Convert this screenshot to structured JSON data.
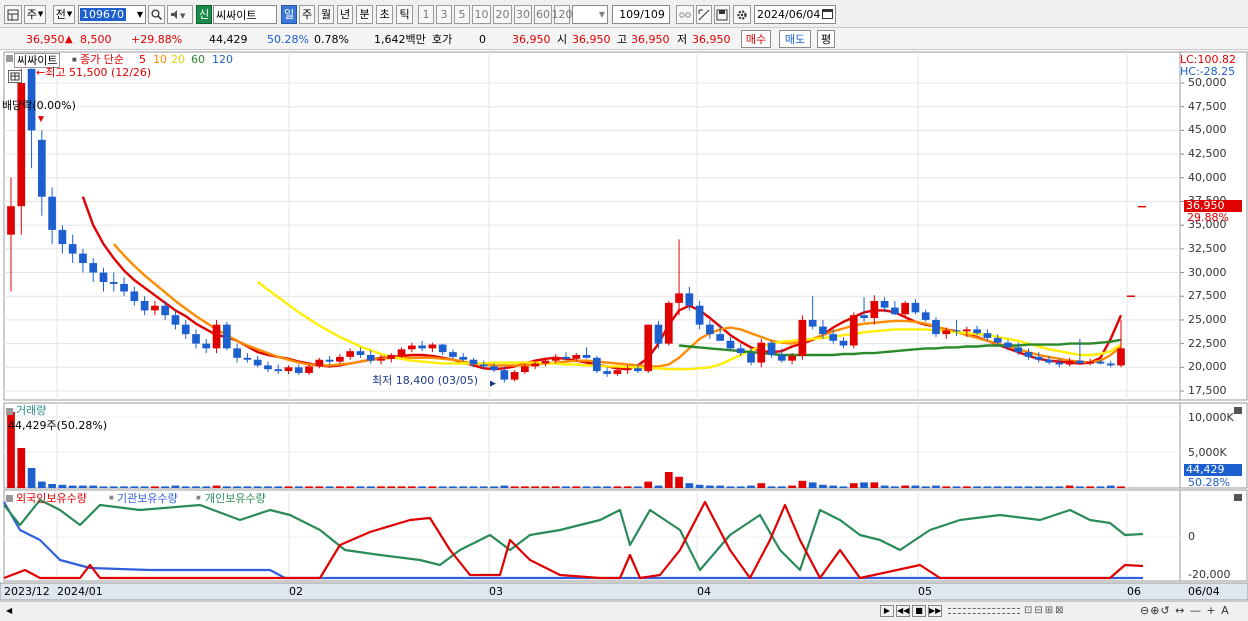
{
  "toolbar": {
    "period": "주",
    "prev": "전",
    "code": "109670",
    "badge": "신",
    "name": "씨싸이트",
    "periods": [
      "일",
      "주",
      "월",
      "년",
      "분",
      "초",
      "틱"
    ],
    "active_period": "일",
    "intervals": [
      "1",
      "3",
      "5",
      "10",
      "20",
      "30",
      "60",
      "120"
    ],
    "count": "109",
    "count_total": "/109",
    "date": "2024/06/04"
  },
  "quote": {
    "price": "36,950",
    "change": "8,500",
    "change_pct": "+29.88%",
    "volume": "44,429",
    "vol_ratio": "50.28%",
    "turnover": "0.78%",
    "amount": "1,642백만",
    "hoga_label": "호가",
    "hoga_value": "0",
    "hoga_price": "36,950",
    "open_label": "시",
    "open": "36,950",
    "high_label": "고",
    "high": "36,950",
    "low_label": "저",
    "low": "36,950",
    "buy": "매수",
    "sell": "매도",
    "avg": "평"
  },
  "price_panel": {
    "name": "씨싸이트",
    "ma_label": "종가 단순",
    "ma_periods": [
      "5",
      "10",
      "20",
      "60",
      "120"
    ],
    "ma_colors": [
      "#e00000",
      "#ff8c00",
      "#ffee00",
      "#2a8a2a",
      "#1e64c8"
    ],
    "high_note": "←최고 51,500 (12/26)",
    "low_note": "최저 18,400 (03/05)",
    "dividend": "배당락(0.00%)",
    "lc": "LC:100.82",
    "hc": "HC:-28.25",
    "current_price_tag": "36,950",
    "current_pct_tag": "29.88%",
    "y_ticks": [
      "50,000",
      "47,500",
      "45,000",
      "42,500",
      "40,000",
      "37,500",
      "35,000",
      "32,500",
      "30,000",
      "27,500",
      "25,000",
      "22,500",
      "20,000",
      "17,500"
    ]
  },
  "volume_panel": {
    "title": "거래량",
    "note": "44,429주(50.28%)",
    "y_ticks": [
      "10,000K",
      "5,000K"
    ],
    "value_tag": "44,429",
    "pct_tag": "50.28%"
  },
  "holding_panel": {
    "legend": [
      "외국인보유수량",
      "기관보유수량",
      "개인보유수량"
    ],
    "legend_colors": [
      "#e00000",
      "#3060e0",
      "#2a8a5a"
    ],
    "y_ticks": [
      "0",
      "-20,000"
    ]
  },
  "x_axis": {
    "labels": [
      "2023/12",
      "2024/01",
      "02",
      "03",
      "04",
      "05",
      "06"
    ],
    "end_label": "06/04"
  },
  "colors": {
    "up": "#e00000",
    "down": "#1e5fd0",
    "accent_tag": "#e00000"
  },
  "chart_data": {
    "type": "candlestick",
    "y_range": [
      16000,
      52000
    ],
    "series": [
      {
        "name": "candles",
        "ohlc": [
          [
            34000,
            40000,
            28000,
            37000
          ],
          [
            37000,
            51500,
            34000,
            50000
          ],
          [
            51500,
            51500,
            41000,
            45000
          ],
          [
            44000,
            45000,
            36000,
            38000
          ],
          [
            38000,
            39000,
            33000,
            34500
          ],
          [
            34500,
            35000,
            32000,
            33000
          ],
          [
            33000,
            34000,
            31000,
            32000
          ],
          [
            32000,
            32500,
            30000,
            31000
          ],
          [
            31000,
            31500,
            29000,
            30000
          ],
          [
            30000,
            30500,
            28000,
            29000
          ],
          [
            29000,
            30000,
            28000,
            28800
          ],
          [
            28800,
            29500,
            27500,
            28000
          ],
          [
            28000,
            28500,
            26500,
            27000
          ],
          [
            27000,
            27500,
            25500,
            26000
          ],
          [
            26000,
            27000,
            25500,
            26500
          ],
          [
            26500,
            27000,
            25000,
            25500
          ],
          [
            25500,
            26000,
            24000,
            24500
          ],
          [
            24500,
            25000,
            23000,
            23500
          ],
          [
            23500,
            24000,
            22000,
            22500
          ],
          [
            22500,
            23000,
            21500,
            22000
          ],
          [
            22000,
            25000,
            21500,
            24500
          ],
          [
            24500,
            24800,
            21800,
            22000
          ],
          [
            22000,
            22500,
            20500,
            21000
          ],
          [
            21000,
            21500,
            20500,
            20800
          ],
          [
            20800,
            21200,
            20000,
            20200
          ],
          [
            20200,
            20600,
            19500,
            19800
          ],
          [
            19800,
            20300,
            19300,
            19600
          ],
          [
            19600,
            20200,
            19300,
            20000
          ],
          [
            20000,
            20300,
            19200,
            19400
          ],
          [
            19400,
            20300,
            19200,
            20100
          ],
          [
            20100,
            21000,
            19900,
            20800
          ],
          [
            20800,
            21200,
            20300,
            20600
          ],
          [
            20600,
            21400,
            20400,
            21100
          ],
          [
            21100,
            22000,
            20800,
            21700
          ],
          [
            21700,
            22100,
            21000,
            21300
          ],
          [
            21300,
            21800,
            20400,
            20700
          ],
          [
            20700,
            21300,
            20300,
            20900
          ],
          [
            20900,
            21500,
            20500,
            21300
          ],
          [
            21300,
            22100,
            21000,
            21900
          ],
          [
            21900,
            22600,
            21600,
            22300
          ],
          [
            22300,
            22800,
            21700,
            22000
          ],
          [
            22000,
            22600,
            21600,
            22400
          ],
          [
            22400,
            22500,
            21300,
            21600
          ],
          [
            21600,
            21900,
            20900,
            21100
          ],
          [
            21100,
            21500,
            20600,
            20800
          ],
          [
            20800,
            21000,
            20000,
            20300
          ],
          [
            20300,
            20700,
            19800,
            20100
          ],
          [
            20100,
            20400,
            19500,
            19700
          ],
          [
            19700,
            20100,
            18400,
            18700
          ],
          [
            18700,
            19700,
            18500,
            19500
          ],
          [
            19500,
            20400,
            19300,
            20100
          ],
          [
            20100,
            20600,
            19800,
            20400
          ],
          [
            20400,
            21000,
            20100,
            20700
          ],
          [
            20700,
            21400,
            20400,
            21100
          ],
          [
            21100,
            21600,
            20700,
            20900
          ],
          [
            20900,
            21500,
            20600,
            21300
          ],
          [
            21300,
            22100,
            20900,
            21000
          ],
          [
            21000,
            21200,
            19400,
            19600
          ],
          [
            19600,
            20000,
            19000,
            19300
          ],
          [
            19300,
            19900,
            19100,
            19700
          ],
          [
            19700,
            20200,
            19300,
            19900
          ],
          [
            19900,
            20300,
            19400,
            19600
          ],
          [
            19600,
            24500,
            19400,
            24500
          ],
          [
            24500,
            24900,
            22000,
            22500
          ],
          [
            22500,
            27000,
            22300,
            26800
          ],
          [
            26800,
            33500,
            25500,
            27800
          ],
          [
            27800,
            28500,
            26000,
            26500
          ],
          [
            26500,
            27000,
            24000,
            24500
          ],
          [
            24500,
            25000,
            23000,
            23500
          ],
          [
            23500,
            24500,
            22800,
            22800
          ],
          [
            22800,
            23200,
            21800,
            22000
          ],
          [
            22000,
            22500,
            21200,
            21500
          ],
          [
            21500,
            22000,
            20200,
            20500
          ],
          [
            20500,
            23000,
            20000,
            22600
          ],
          [
            22600,
            22800,
            21000,
            21300
          ],
          [
            21300,
            22000,
            20500,
            20700
          ],
          [
            20700,
            21500,
            20300,
            21200
          ],
          [
            21200,
            25500,
            20800,
            25000
          ],
          [
            25000,
            27500,
            24000,
            24300
          ],
          [
            24300,
            25000,
            23000,
            23500
          ],
          [
            23500,
            24000,
            22500,
            22800
          ],
          [
            22800,
            23200,
            22000,
            22300
          ],
          [
            22300,
            25800,
            22000,
            25500
          ],
          [
            25500,
            27400,
            24800,
            25200
          ],
          [
            25200,
            27600,
            24500,
            27000
          ],
          [
            27000,
            27400,
            25800,
            26300
          ],
          [
            26300,
            27000,
            25500,
            25600
          ],
          [
            25600,
            27000,
            25300,
            26800
          ],
          [
            26800,
            27200,
            25600,
            25800
          ],
          [
            25800,
            26100,
            24800,
            25000
          ],
          [
            25000,
            25300,
            23200,
            23500
          ],
          [
            23500,
            24200,
            23000,
            23900
          ],
          [
            23900,
            25000,
            23300,
            23800
          ],
          [
            23800,
            24300,
            23200,
            24000
          ],
          [
            24000,
            24400,
            23400,
            23600
          ],
          [
            23600,
            24000,
            22800,
            23100
          ],
          [
            23100,
            23500,
            22300,
            22600
          ],
          [
            22600,
            22900,
            21800,
            22100
          ],
          [
            22100,
            22600,
            21300,
            21600
          ],
          [
            21600,
            22000,
            20800,
            21100
          ],
          [
            21100,
            21600,
            20500,
            20800
          ],
          [
            20800,
            21200,
            20300,
            20500
          ],
          [
            20500,
            20900,
            20000,
            20300
          ],
          [
            20300,
            21000,
            20100,
            20700
          ],
          [
            20700,
            23000,
            20400,
            20400
          ],
          [
            20400,
            20900,
            20200,
            20600
          ],
          [
            20600,
            20800,
            20300,
            20400
          ],
          [
            20400,
            20700,
            20000,
            20200
          ],
          [
            20200,
            25000,
            20000,
            22000
          ]
        ]
      },
      {
        "name": "5",
        "values": [
          38000,
          35000,
          33000,
          31500,
          30200,
          29200,
          28400,
          27600,
          26800,
          26000,
          25400,
          24600,
          24000,
          23400,
          23200,
          22800,
          22200,
          21600,
          21300,
          21100,
          20900,
          20600,
          20400,
          20200,
          20100,
          20200,
          20400,
          20600,
          20800,
          21000,
          21100,
          21200,
          21300,
          21300,
          21200,
          21000,
          20800,
          20500,
          20200,
          19900,
          19800,
          19900,
          20100,
          20400,
          20700,
          20900,
          21000,
          20900,
          20700,
          20500,
          20300,
          20100,
          19900,
          19800,
          20200,
          21000,
          22500,
          24500,
          26000,
          26500,
          26000,
          25200,
          24300,
          23400,
          22700,
          22100,
          21700,
          21600,
          21700,
          22200,
          22500,
          22900,
          23400,
          24200,
          24800,
          25300,
          25800,
          26000,
          26000,
          25800,
          25300,
          24800,
          24500,
          24300,
          24000,
          23800,
          23500,
          23200,
          22800,
          22400,
          22000,
          21600,
          21200,
          20900,
          20700,
          20600,
          20500,
          20400,
          20500,
          21000,
          23000,
          25500
        ]
      },
      {
        "name": "10",
        "values": [
          33000,
          31800,
          30700,
          29700,
          28800,
          27900,
          27000,
          26200,
          25400,
          24700,
          24000,
          23400,
          22800,
          22300,
          21900,
          21500,
          21100,
          20800,
          20500,
          20300,
          20200,
          20200,
          20300,
          20400,
          20600,
          20800,
          20900,
          21000,
          21000,
          21000,
          21000,
          21000,
          20900,
          20800,
          20600,
          20400,
          20300,
          20200,
          20200,
          20200,
          20200,
          20300,
          20400,
          20500,
          20600,
          20700,
          20700,
          20600,
          20500,
          20400,
          20300,
          20200,
          20100,
          20100,
          20300,
          21000,
          22000,
          23000,
          23600,
          24000,
          24200,
          24000,
          23600,
          23200,
          22800,
          22600,
          22500,
          22700,
          23000,
          23400,
          23800,
          24100,
          24400,
          24600,
          24700,
          24800,
          24900,
          24900,
          24800,
          24600,
          24300,
          24000,
          23700,
          23400,
          23100,
          22800,
          22500,
          22200,
          21900,
          21600,
          21300,
          21100,
          20900,
          20700,
          20600,
          20500,
          20700,
          21300,
          22200
        ]
      },
      {
        "name": "20",
        "values": [
          29000,
          28200,
          27400,
          26600,
          25800,
          25100,
          24400,
          23800,
          23200,
          22700,
          22200,
          21800,
          21400,
          21100,
          20900,
          20700,
          20600,
          20500,
          20400,
          20400,
          20400,
          20400,
          20400,
          20500,
          20500,
          20500,
          20500,
          20500,
          20400,
          20400,
          20300,
          20300,
          20200,
          20200,
          20100,
          20100,
          20000,
          20000,
          19900,
          19900,
          19800,
          19800,
          19800,
          19900,
          20000,
          20300,
          20800,
          21300,
          21800,
          22200,
          22500,
          22700,
          22800,
          22900,
          23000,
          23100,
          23200,
          23400,
          23500,
          23700,
          23800,
          23900,
          24000,
          24000,
          24000,
          24000,
          23900,
          23800,
          23700,
          23600,
          23500,
          23400,
          23200,
          23000,
          22800,
          22500,
          22200,
          21900,
          21700,
          21500,
          21300,
          21300,
          21400,
          21700,
          22400
        ]
      },
      {
        "name": "60",
        "values": [
          22300,
          22200,
          22100,
          22000,
          21900,
          21800,
          21700,
          21600,
          21500,
          21400,
          21300,
          21300,
          21300,
          21300,
          21300,
          21300,
          21400,
          21400,
          21500,
          21500,
          21600,
          21700,
          21800,
          21900,
          22000,
          22000,
          22100,
          22100,
          22200,
          22200,
          22300,
          22300,
          22300,
          22300,
          22400,
          22400,
          22400,
          22400,
          22500,
          22500,
          22500,
          22600,
          22700,
          22900
        ]
      },
      {
        "name": "120",
        "values": []
      }
    ]
  }
}
